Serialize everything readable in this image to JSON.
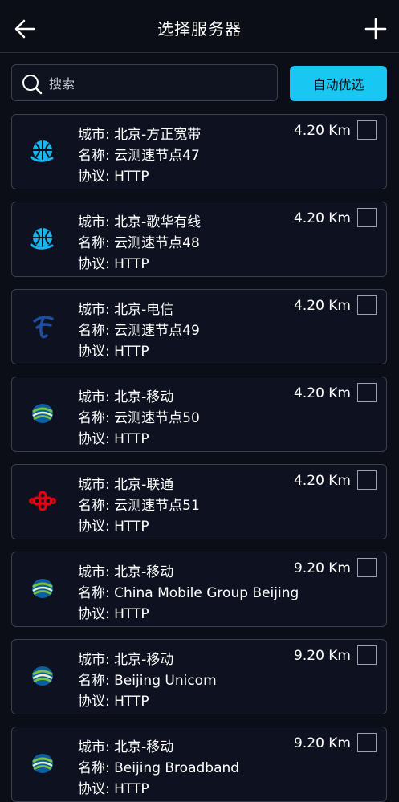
{
  "header": {
    "title": "选择服务器"
  },
  "search": {
    "placeholder": "搜索"
  },
  "auto_button": "自动优选",
  "servers": [
    {
      "city": "城市: 北京-方正宽带",
      "name": "名称: 云测速节点47",
      "protocol": "协议: HTTP",
      "distance": "4.20 Km",
      "logo": "globe-icon"
    },
    {
      "city": "城市: 北京-歌华有线",
      "name": "名称: 云测速节点48",
      "protocol": "协议: HTTP",
      "distance": "4.20 Km",
      "logo": "globe-icon"
    },
    {
      "city": "城市: 北京-电信",
      "name": "名称: 云测速节点49",
      "protocol": "协议: HTTP",
      "distance": "4.20 Km",
      "logo": "china-telecom-icon"
    },
    {
      "city": "城市: 北京-移动",
      "name": "名称: 云测速节点50",
      "protocol": "协议: HTTP",
      "distance": "4.20 Km",
      "logo": "china-mobile-icon"
    },
    {
      "city": "城市: 北京-联通",
      "name": "名称: 云测速节点51",
      "protocol": "协议: HTTP",
      "distance": "4.20 Km",
      "logo": "china-unicom-icon"
    },
    {
      "city": "城市: 北京-移动",
      "name": "名称: China Mobile Group Beijing",
      "protocol": "协议: HTTP",
      "distance": "9.20 Km",
      "logo": "china-mobile-icon"
    },
    {
      "city": "城市: 北京-移动",
      "name": "名称: Beijing Unicom",
      "protocol": "协议: HTTP",
      "distance": "9.20 Km",
      "logo": "china-mobile-icon"
    },
    {
      "city": "城市: 北京-移动",
      "name": "名称: Beijing Broadband",
      "protocol": "协议: HTTP",
      "distance": "9.20 Km",
      "logo": "china-mobile-icon"
    }
  ],
  "colors": {
    "accent": "#19c8f2",
    "background": "#0b0e17",
    "unicom_red": "#e60012",
    "telecom_blue": "#1e4fa3",
    "mobile_green": "#7cc242"
  }
}
